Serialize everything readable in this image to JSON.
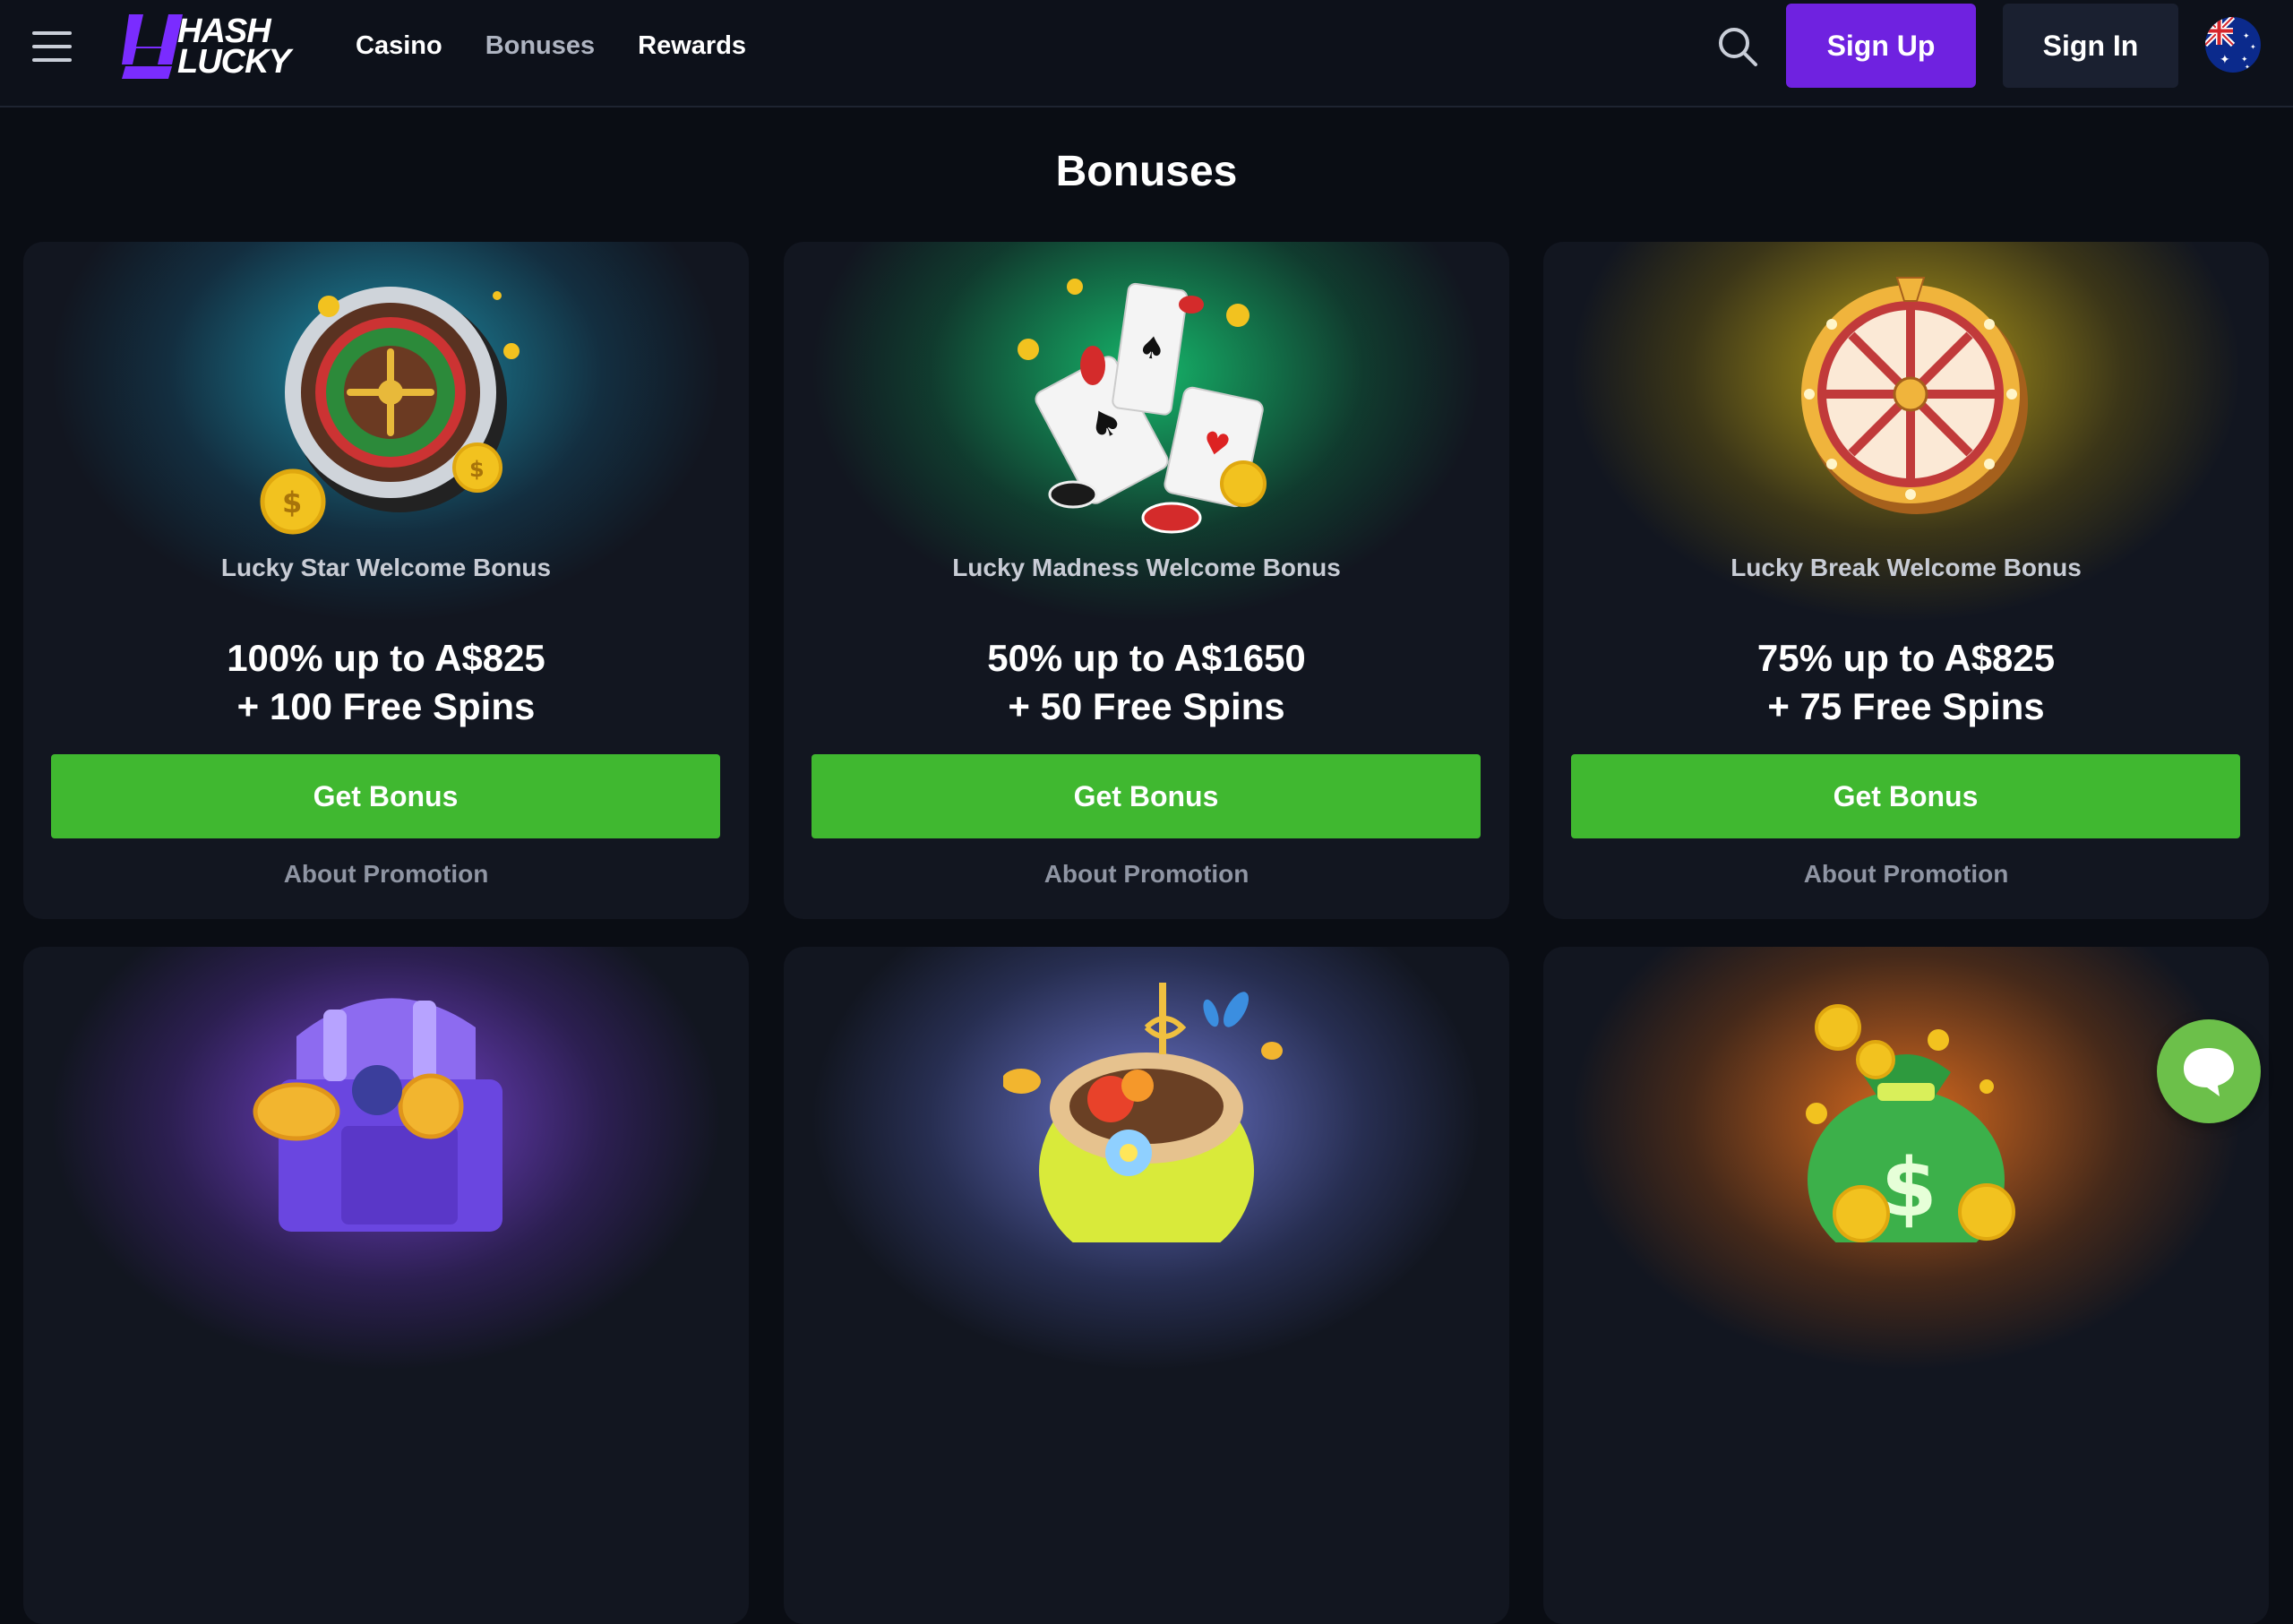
{
  "header": {
    "logo_text_line1": "HASH",
    "logo_text_line2": "LUCKY",
    "nav": [
      {
        "label": "Casino"
      },
      {
        "label": "Bonuses"
      },
      {
        "label": "Rewards"
      }
    ],
    "signup_label": "Sign Up",
    "signin_label": "Sign In",
    "language_flag": "australia-flag-icon"
  },
  "page": {
    "title": "Bonuses"
  },
  "bonuses": [
    {
      "name": "Lucky Star Welcome Bonus",
      "offer_line1": "100% up to A$825",
      "offer_line2": "+ 100 Free Spins",
      "button_label": "Get Bonus",
      "link_label": "About Promotion",
      "art": "roulette-wheel-icon",
      "glow_color": "#1e8fa6"
    },
    {
      "name": "Lucky Madness Welcome Bonus",
      "offer_line1": "50% up to A$1650",
      "offer_line2": "+ 50 Free Spins",
      "button_label": "Get Bonus",
      "link_label": "About Promotion",
      "art": "playing-cards-icon",
      "glow_color": "#17b06a"
    },
    {
      "name": "Lucky Break Welcome Bonus",
      "offer_line1": "75% up to A$825",
      "offer_line2": "+ 75 Free Spins",
      "button_label": "Get Bonus",
      "link_label": "About Promotion",
      "art": "prize-wheel-icon",
      "glow_color": "#b39d1a"
    },
    {
      "art": "treasure-chest-icon",
      "glow_color": "#7a3fd6"
    },
    {
      "art": "cocktail-coconut-icon",
      "glow_color": "#6672c8"
    },
    {
      "art": "money-bag-icon",
      "glow_color": "#d8661c"
    }
  ],
  "chat": {
    "icon": "chat-bubble-icon"
  }
}
